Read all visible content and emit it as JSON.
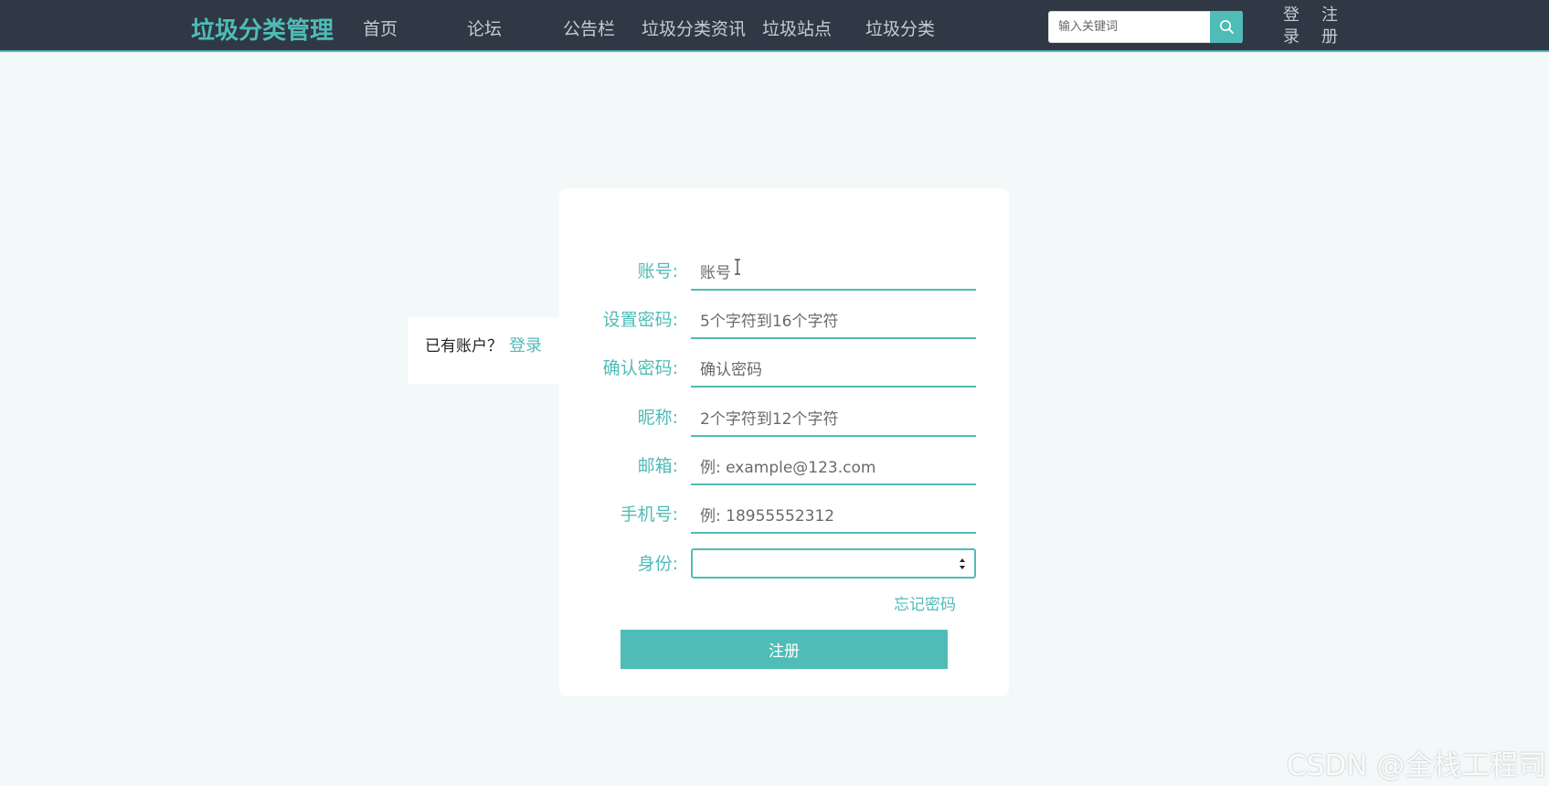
{
  "header": {
    "brand": "垃圾分类管理",
    "nav": [
      "首页",
      "论坛",
      "公告栏",
      "垃圾分类资讯",
      "垃圾站点",
      "垃圾分类"
    ],
    "search_placeholder": "输入关键词",
    "login": "登录",
    "register": "注册"
  },
  "side": {
    "text": "已有账户？",
    "login_link": "登录"
  },
  "form": {
    "fields": [
      {
        "label": "账号:",
        "placeholder": "账号"
      },
      {
        "label": "设置密码:",
        "placeholder": "5个字符到16个字符"
      },
      {
        "label": "确认密码:",
        "placeholder": "确认密码"
      },
      {
        "label": "昵称:",
        "placeholder": "2个字符到12个字符"
      },
      {
        "label": "邮箱:",
        "placeholder": "例: example@123.com"
      },
      {
        "label": "手机号:",
        "placeholder": "例: 18955552312"
      }
    ],
    "role_label": "身份:",
    "role_value": "",
    "forgot": "忘记密码",
    "submit": "注册"
  },
  "watermark": "CSDN @全栈工程司",
  "colors": {
    "accent": "#4fbcb7",
    "topbar": "#2f3844",
    "background": "#f3f8f8"
  }
}
